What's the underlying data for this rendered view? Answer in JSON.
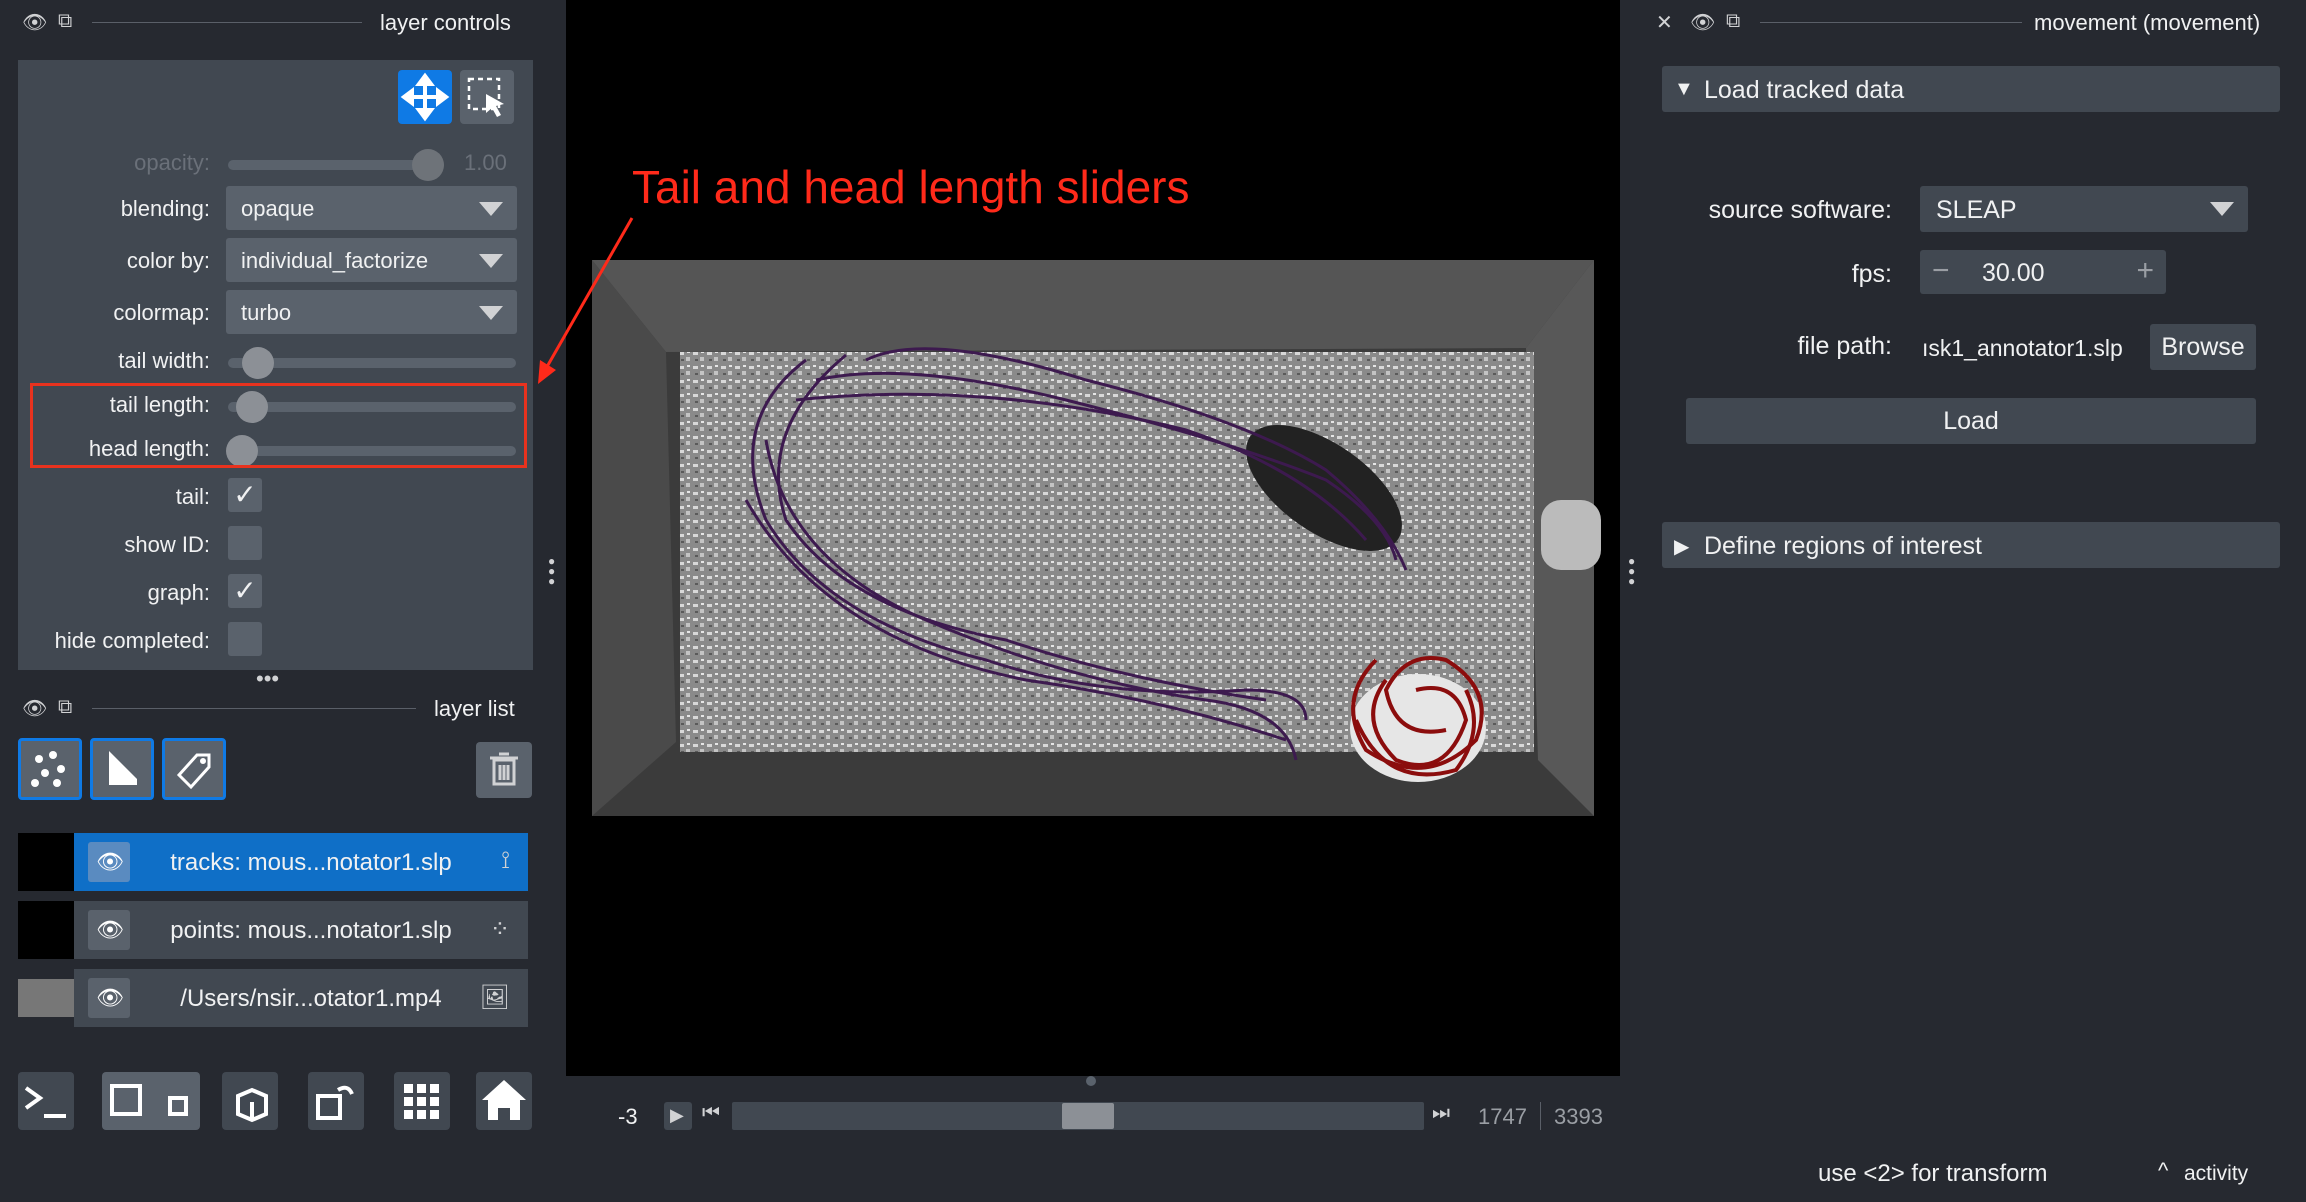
{
  "layer_controls": {
    "title": "layer controls",
    "opacity": {
      "label": "opacity:",
      "value": "1.00",
      "fraction": 1.0
    },
    "blending": {
      "label": "blending:",
      "value": "opaque"
    },
    "color_by": {
      "label": "color by:",
      "value": "individual_factorize"
    },
    "colormap": {
      "label": "colormap:",
      "value": "turbo"
    },
    "tail_width": {
      "label": "tail width:",
      "fraction": 0.1
    },
    "tail_length": {
      "label": "tail length:",
      "fraction": 0.05
    },
    "head_length": {
      "label": "head length:",
      "fraction": 0.0
    },
    "tail": {
      "label": "tail:",
      "checked": true
    },
    "show_id": {
      "label": "show ID:",
      "checked": false
    },
    "graph": {
      "label": "graph:",
      "checked": true
    },
    "hide_completed": {
      "label": "hide completed:",
      "checked": false
    }
  },
  "layer_list": {
    "title": "layer list",
    "layers": [
      {
        "name": "tracks: mous...notator1.slp",
        "selected": true,
        "icon": "tracks-icon"
      },
      {
        "name": "points: mous...notator1.slp",
        "selected": false,
        "icon": "points-icon"
      },
      {
        "name": "/Users/nsir...otator1.mp4",
        "selected": false,
        "icon": "image-icon"
      }
    ]
  },
  "annotation": {
    "text": "Tail and head length sliders",
    "color": "#ff2a1a"
  },
  "dims_slider": {
    "left_value": "-3",
    "current_frame": "1747",
    "total_frames": "3393",
    "position_fraction": 0.5
  },
  "plugin": {
    "title": "movement (movement)",
    "load_section": {
      "title": "Load tracked data",
      "source_software_label": "source software:",
      "source_software_value": "SLEAP",
      "fps_label": "fps:",
      "fps_value": "30.00",
      "file_path_label": "file path:",
      "file_path_value": "ısk1_annotator1.slp",
      "browse_label": "Browse",
      "load_label": "Load"
    },
    "roi_section": {
      "title": "Define regions of interest"
    }
  },
  "status": {
    "text": "use <2> for transform",
    "activity": "activity"
  },
  "colors": {
    "accent": "#0f6fc7",
    "panel": "#414851",
    "background": "#262930",
    "track_purple": "#3d1a4f",
    "track_red": "#8b0d0d"
  }
}
